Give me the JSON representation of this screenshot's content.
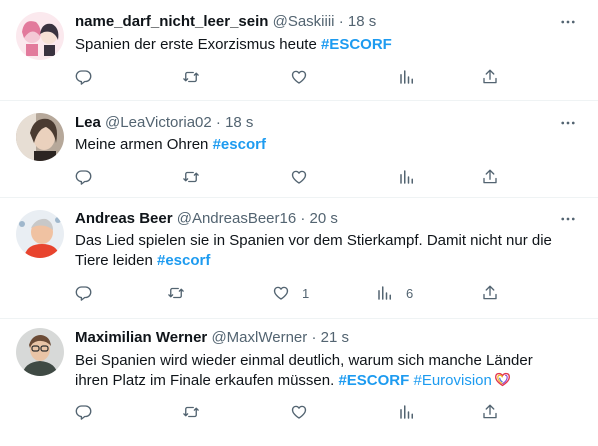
{
  "tweets": [
    {
      "name": "name_darf_nicht_leer_sein",
      "handle": "@Saskiiii",
      "time": "18 s",
      "text_plain": "Spanien der erste Exorzismus heute ",
      "hashtags": [
        "#ESCORF"
      ],
      "reply_count": "",
      "retweet_count": "",
      "like_count": "",
      "view_count": "",
      "avatar_colors": {
        "bg": "#fbe9ee",
        "accent": "#e27a9c",
        "dark": "#3a3340"
      }
    },
    {
      "name": "Lea",
      "handle": "@LeaVictoria02",
      "time": "18 s",
      "text_plain": "Meine armen Ohren ",
      "hashtags": [
        "#escorf"
      ],
      "reply_count": "",
      "retweet_count": "",
      "like_count": "",
      "view_count": "",
      "avatar_colors": {
        "bg": "#b6a89a",
        "accent": "#e7ded4",
        "dark": "#4a3b31"
      }
    },
    {
      "name": "Andreas Beer",
      "handle": "@AndreasBeer16",
      "time": "20 s",
      "text_line1": "Das Lied spielen sie in Spanien vor dem Stierkampf. Damit nicht nur die",
      "text_line2": "Tiere leiden ",
      "hashtags": [
        "#escorf"
      ],
      "reply_count": "",
      "retweet_count": "",
      "like_count": "1",
      "view_count": "6",
      "avatar_colors": {
        "bg": "#e9eef3",
        "accent": "#e8442e",
        "dark": "#f0c2a2"
      }
    },
    {
      "name": "Maximilian Werner",
      "handle": "@MaxlWerner",
      "time": "21 s",
      "text_line1": "Bei Spanien wird wieder einmal deutlich, warum sich manche Länder",
      "text_line2": "ihren Platz im Finale erkaufen müssen. ",
      "hashtags": [
        "#ESCORF",
        "#Eurovision"
      ],
      "reply_count": "",
      "retweet_count": "",
      "like_count": "",
      "view_count": "",
      "avatar_colors": {
        "bg": "#d7d9d8",
        "accent": "#3f4a44",
        "dark": "#6b4b36"
      }
    }
  ],
  "colors": {
    "link": "#1d9bf0",
    "muted": "#536471",
    "text": "#0f1419",
    "divider": "#eff3f4"
  },
  "icons": {
    "more": "more-icon",
    "reply": "reply-icon",
    "retweet": "retweet-icon",
    "like": "like-icon",
    "views": "views-icon",
    "share": "share-icon",
    "eurovision": "eurovision-heart-icon"
  }
}
